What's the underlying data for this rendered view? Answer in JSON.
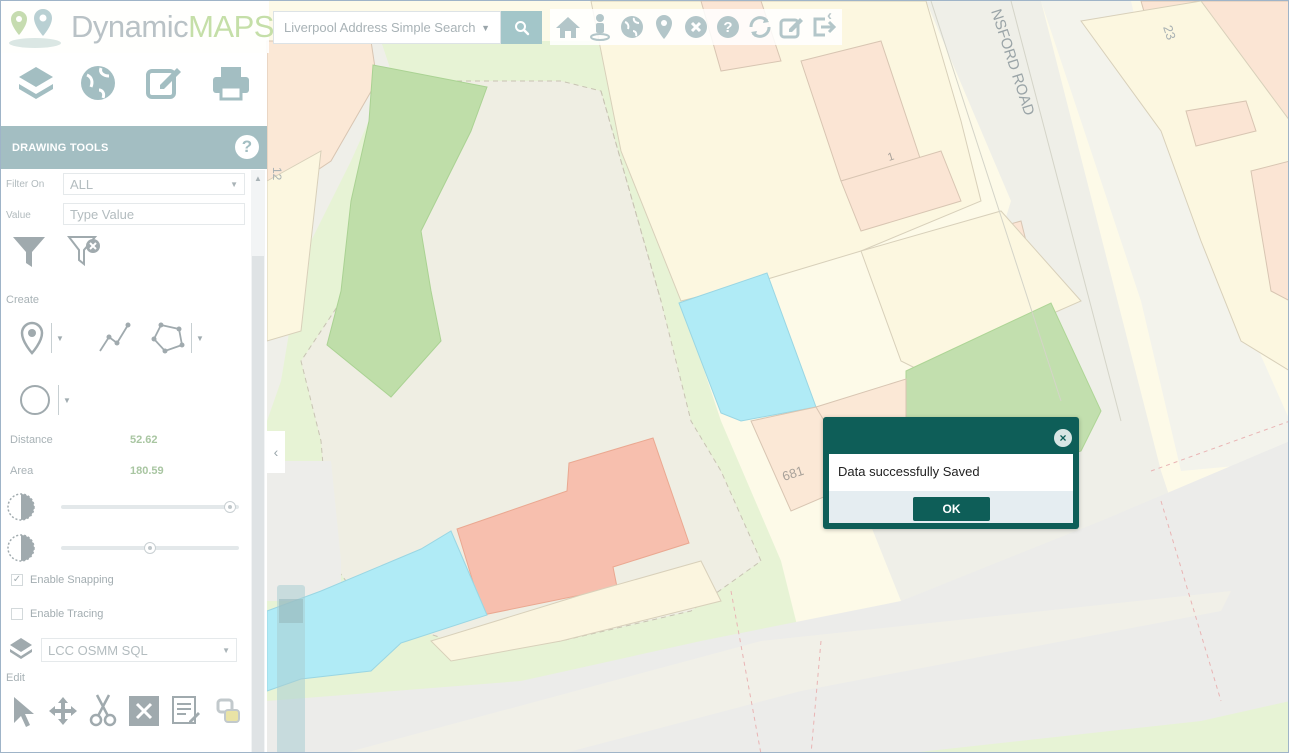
{
  "app": {
    "logo_part1": "Dynamic",
    "logo_part2": "MAPS"
  },
  "search": {
    "placeholder": "Liverpool Address Simple Search"
  },
  "toolbar_icons": [
    "home-icon",
    "street-view-icon",
    "globe-icon",
    "map-marker-icon",
    "close-circle-icon",
    "help-icon",
    "refresh-icon",
    "edit-icon",
    "logout-icon"
  ],
  "panel": {
    "title": "DRAWING TOOLS",
    "help_glyph": "?",
    "filter_on_label": "Filter On",
    "filter_on_value": "ALL",
    "value_label": "Value",
    "value_placeholder": "Type Value",
    "create_label": "Create",
    "distance_label": "Distance",
    "distance_value": "52.62",
    "area_label": "Area",
    "area_value": "180.59",
    "opacity_slider_1": 0.98,
    "opacity_slider_2": 0.5,
    "enable_snapping_label": "Enable Snapping",
    "enable_snapping_checked": true,
    "enable_tracing_label": "Enable Tracing",
    "enable_tracing_checked": false,
    "layer_value": "LCC OSMM SQL",
    "edit_label": "Edit"
  },
  "map_labels": {
    "road": "NSFORD ROAD",
    "num_23": "23",
    "num_12": "12",
    "num_681": "681",
    "num_1": "1"
  },
  "dialog": {
    "message": "Data successfully Saved",
    "ok_label": "OK"
  },
  "colors": {
    "accent": "#0e5e58",
    "panel_header": "#a3bec2",
    "blue_building": "#aeeaf6",
    "red_building": "#f7bfae",
    "green_area": "#c2dfae"
  }
}
